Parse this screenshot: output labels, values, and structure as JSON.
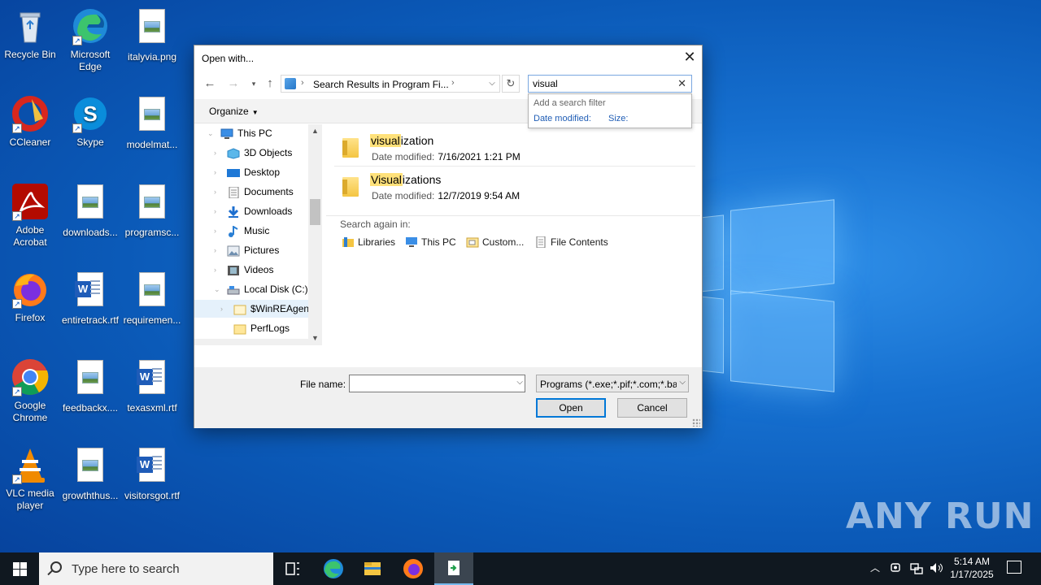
{
  "desktop": {
    "icons": [
      {
        "label": "Recycle Bin"
      },
      {
        "label": "Microsoft Edge"
      },
      {
        "label": "italyvia.png"
      },
      {
        "label": "CCleaner"
      },
      {
        "label": "Skype"
      },
      {
        "label": "modelmat..."
      },
      {
        "label": "Adobe Acrobat"
      },
      {
        "label": "downloads..."
      },
      {
        "label": "programsc..."
      },
      {
        "label": "Firefox"
      },
      {
        "label": "entiretrack.rtf"
      },
      {
        "label": "requiremen..."
      },
      {
        "label": "Google Chrome"
      },
      {
        "label": "feedbackx...."
      },
      {
        "label": "texasxml.rtf"
      },
      {
        "label": "VLC media player"
      },
      {
        "label": "growththus..."
      },
      {
        "label": "visitorsgot.rtf"
      }
    ],
    "watermark": "ANY RUN"
  },
  "dialog": {
    "title": "Open with...",
    "close_glyph": "✕",
    "address": "Search Results in Program Fi...",
    "search": {
      "value": "visual",
      "hint": "Add a search filter",
      "filters": [
        "Date modified:",
        "Size:"
      ]
    },
    "organize_label": "Organize",
    "tree": [
      {
        "label": "This PC",
        "icon": "pc-icon"
      },
      {
        "label": "3D Objects",
        "icon": "3d-objects-icon"
      },
      {
        "label": "Desktop",
        "icon": "desktop-icon"
      },
      {
        "label": "Documents",
        "icon": "documents-icon"
      },
      {
        "label": "Downloads",
        "icon": "downloads-icon"
      },
      {
        "label": "Music",
        "icon": "music-icon"
      },
      {
        "label": "Pictures",
        "icon": "pictures-icon"
      },
      {
        "label": "Videos",
        "icon": "videos-icon"
      },
      {
        "label": "Local Disk (C:)",
        "icon": "drive-icon"
      },
      {
        "label": "$WinREAgent",
        "icon": "folder-icon"
      },
      {
        "label": "PerfLogs",
        "icon": "folder-icon"
      }
    ],
    "results": [
      {
        "name_match": "visual",
        "name_rest": "ization",
        "date_label": "Date modified:",
        "date": "7/16/2021 1:21 PM"
      },
      {
        "name_match": "Visual",
        "name_rest": "izations",
        "date_label": "Date modified:",
        "date": "12/7/2019 9:54 AM"
      }
    ],
    "search_again_label": "Search again in:",
    "search_again": [
      "Libraries",
      "This PC",
      "Custom...",
      "File Contents"
    ],
    "file_name_label": "File name:",
    "file_name_value": "",
    "file_type": "Programs (*.exe;*.pif;*.com;*.ba",
    "open_label": "Open",
    "cancel_label": "Cancel"
  },
  "taskbar": {
    "search_placeholder": "Type here to search",
    "time": "5:14 AM",
    "date": "1/17/2025"
  }
}
